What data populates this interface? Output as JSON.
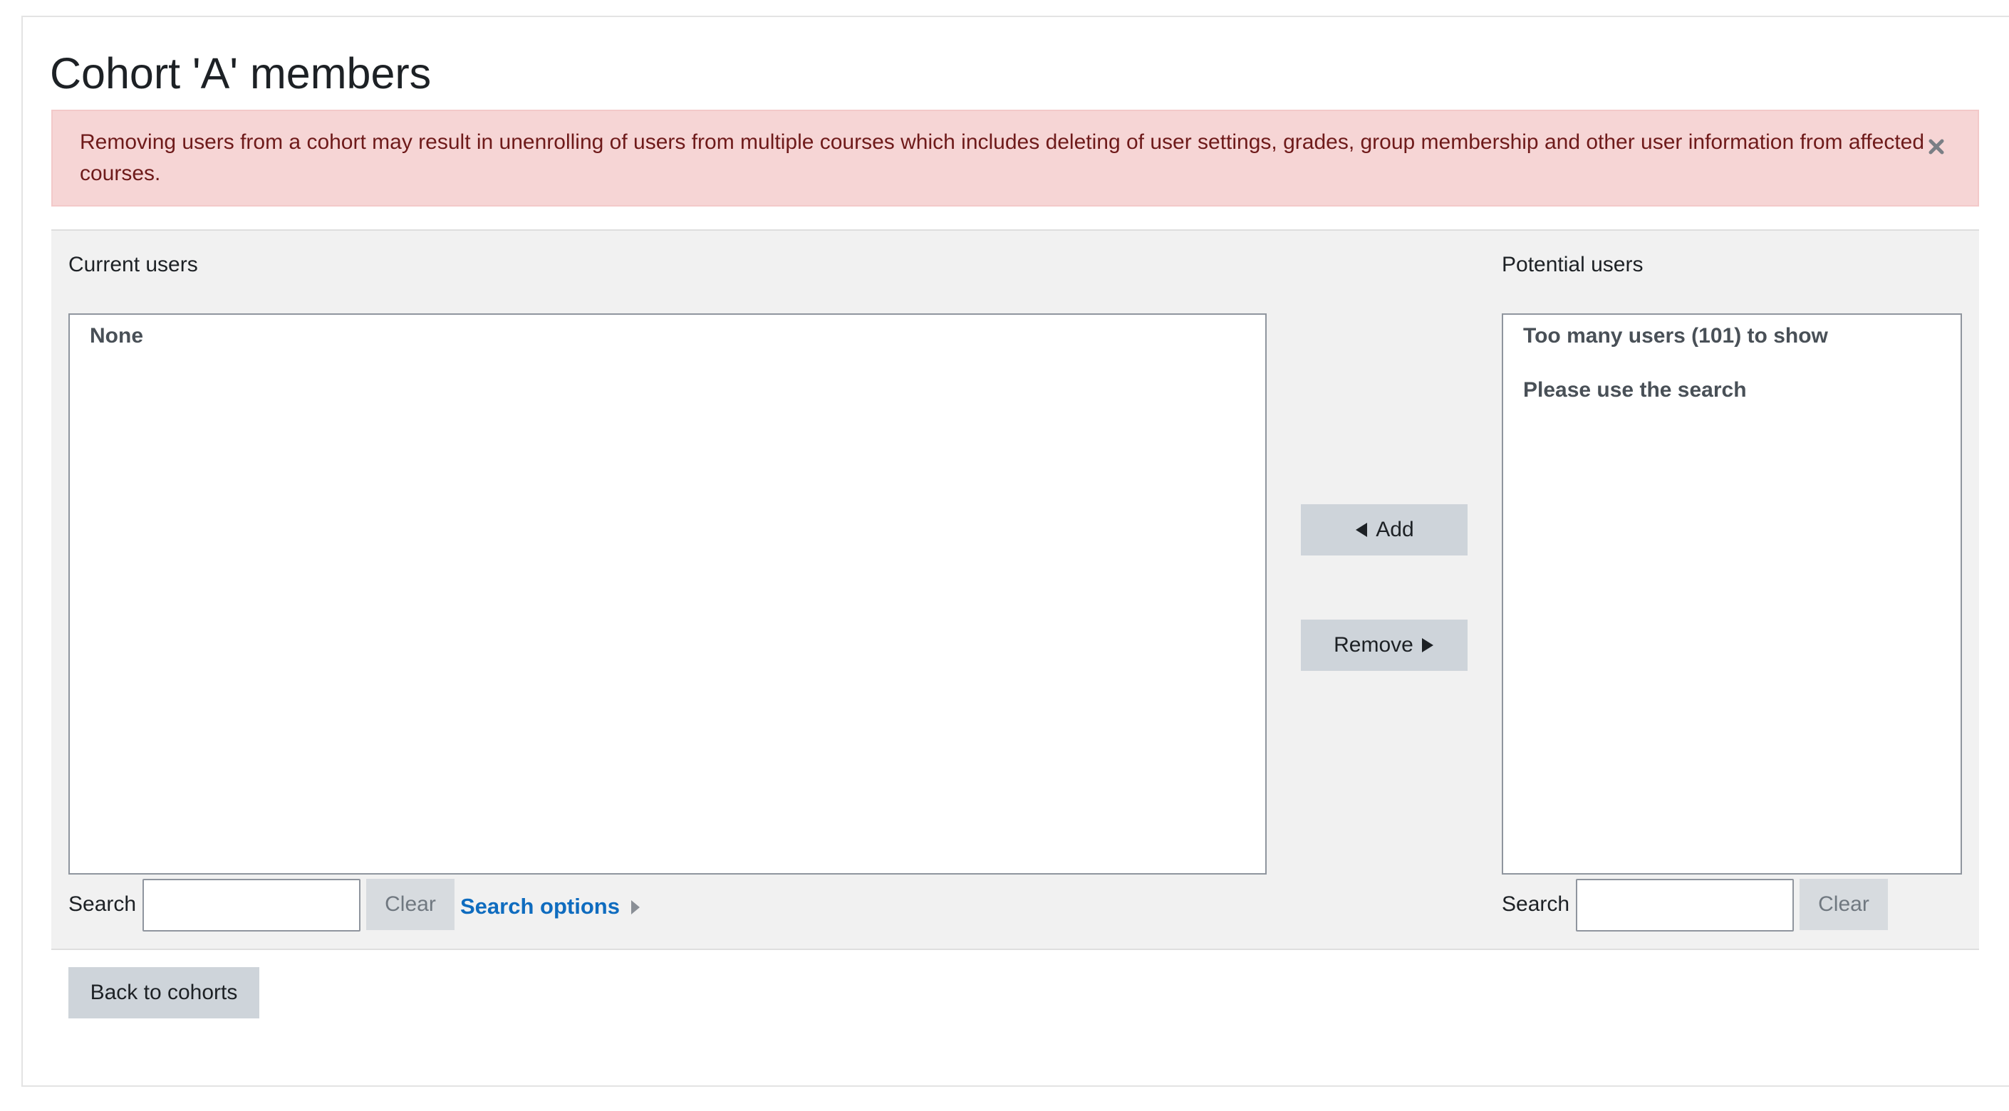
{
  "page": {
    "title": "Cohort 'A' members"
  },
  "alert": {
    "message": "Removing users from a cohort may result in unenrolling of users from multiple courses which includes deleting of user settings, grades, group membership and other user information from affected courses.",
    "close_icon": "close-icon"
  },
  "current_users": {
    "label": "Current users",
    "options": [
      "None"
    ],
    "search_label": "Search",
    "search_value": "",
    "clear_label": "Clear",
    "search_options_label": "Search options"
  },
  "actions": {
    "add_label": "Add",
    "add_icon": "triangle-left-icon",
    "remove_label": "Remove",
    "remove_icon": "triangle-right-icon"
  },
  "potential_users": {
    "label": "Potential users",
    "options": [
      "Too many users (101) to show",
      "Please use the search"
    ],
    "search_label": "Search",
    "search_value": "",
    "clear_label": "Clear"
  },
  "footer": {
    "back_label": "Back to cohorts"
  },
  "colors": {
    "alert_bg": "#f6d5d5",
    "alert_text": "#6e1a1a",
    "link": "#0f6cbf",
    "button_bg": "#ced4da",
    "panel_bg": "#f1f1f1"
  }
}
